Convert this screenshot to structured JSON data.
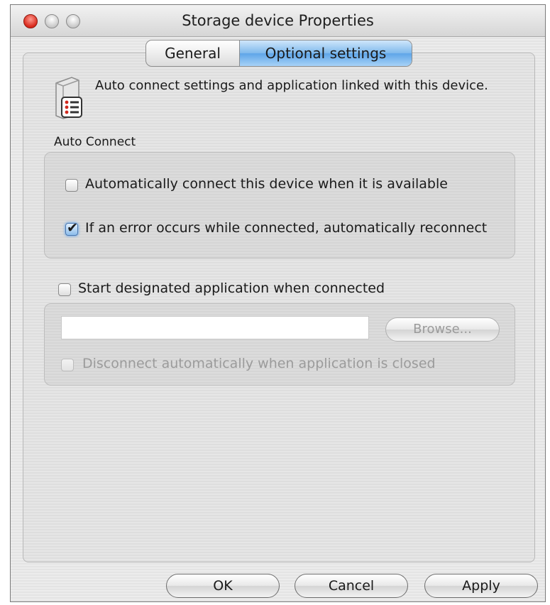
{
  "window": {
    "title": "Storage device Properties"
  },
  "tabs": [
    {
      "label": "General",
      "active": false
    },
    {
      "label": "Optional settings",
      "active": true
    }
  ],
  "description": "Auto connect settings and application linked with this device.",
  "auto_connect": {
    "section_label": "Auto Connect",
    "options": [
      {
        "label": "Automatically connect this device when it is available",
        "checked": false
      },
      {
        "label": "If an error occurs while connected, automatically reconnect",
        "checked": true
      }
    ]
  },
  "application": {
    "start_label": "Start designated application when connected",
    "start_checked": false,
    "path_value": "",
    "browse_label": "Browse...",
    "disconnect_label": "Disconnect automatically when application is closed",
    "disconnect_checked": false
  },
  "footer": {
    "ok_label": "OK",
    "cancel_label": "Cancel",
    "apply_label": "Apply"
  },
  "colors": {
    "accent": "#6aaeea",
    "close_button": "#d8281b"
  }
}
